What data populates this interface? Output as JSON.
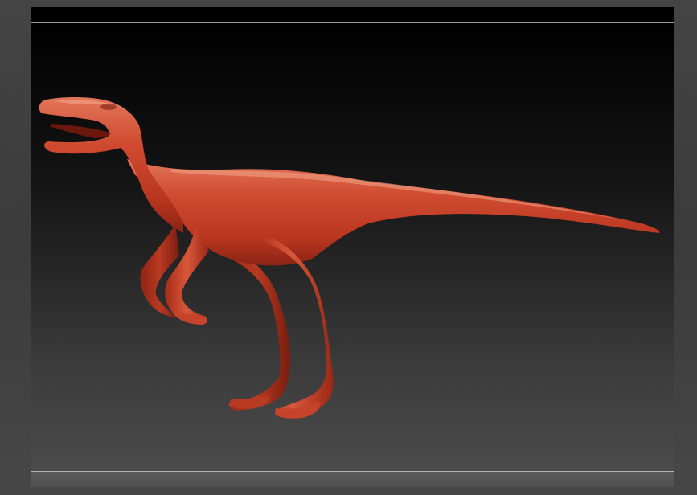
{
  "app": {
    "document_label": "",
    "status_text": ""
  },
  "model": {
    "name": "raptor-sculpt",
    "material_color": "#c9412b",
    "highlight_color": "#e98a6c",
    "shadow_color": "#6e1a10"
  },
  "colors": {
    "frame": "#3d3d3d",
    "viewport_top": "#000000",
    "viewport_bottom": "#4b4b4b"
  }
}
